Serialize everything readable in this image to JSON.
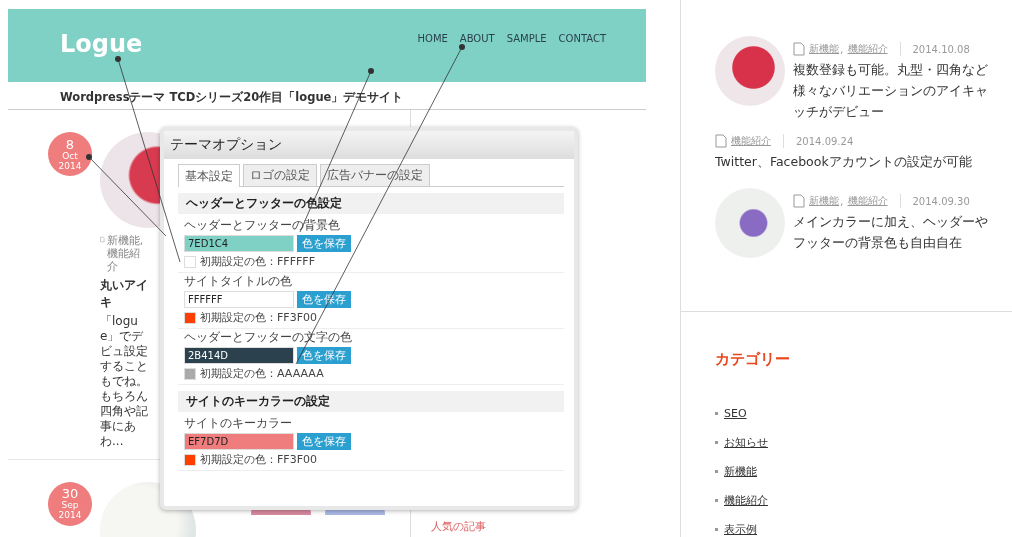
{
  "header": {
    "logo": "Logue",
    "nav": [
      "HOME",
      "ABOUT",
      "SAMPLE",
      "CONTACT"
    ]
  },
  "tagline": "Wordpressテーマ TCDシリーズ20作目「logue」デモサイト",
  "posts": [
    {
      "day": "8",
      "month": "Oct",
      "year": "2014",
      "meta": "新機能, 機能紹介",
      "title": "丸いアイキ",
      "excerpt": "「logue」でデビュ設定することもでね。もちろん四角や記事にあわ..."
    },
    {
      "day": "30",
      "month": "Sep",
      "year": "2014"
    }
  ],
  "middle_column": {
    "heading": "人気の記事"
  },
  "options_panel": {
    "title": "テーマオプション",
    "tabs": [
      {
        "label": "基本設定",
        "selected": true
      },
      {
        "label": "ロゴの設定",
        "selected": false
      },
      {
        "label": "広告バナーの設定",
        "selected": false
      }
    ],
    "sections": [
      {
        "heading": "ヘッダーとフッターの色設定",
        "fields": [
          {
            "label": "ヘッダーとフッターの背景色",
            "value": "7ED1C4",
            "button": "色を保存",
            "default_label": "初期設定の色：",
            "default_value": "FFFFFF"
          },
          {
            "label": "サイトタイトルの色",
            "value": "FFFFFF",
            "button": "色を保存",
            "default_label": "初期設定の色：",
            "default_value": "FF3F00"
          },
          {
            "label": "ヘッダーとフッターの文字の色",
            "value": "2B414D",
            "button": "色を保存",
            "default_label": "初期設定の色：",
            "default_value": "AAAAAA"
          }
        ]
      },
      {
        "heading": "サイトのキーカラーの設定",
        "fields": [
          {
            "label": "サイトのキーカラー",
            "value": "EF7D7D",
            "button": "色を保存",
            "default_label": "初期設定の色：",
            "default_value": "FF3F00"
          }
        ]
      }
    ]
  },
  "sidebar": {
    "category_separator": ",",
    "posts": [
      {
        "kind": "thumb",
        "categories": [
          "新機能",
          "機能紹介"
        ],
        "date": "2014.10.08",
        "title": "複数登録も可能。丸型・四角など様々なバリエーションのアイキャッチがデビュー"
      },
      {
        "kind": "plain",
        "categories": [
          "機能紹介"
        ],
        "date": "2014.09.24",
        "title": "Twitter、Facebookアカウントの設定が可能"
      },
      {
        "kind": "thumb",
        "categories": [
          "新機能",
          "機能紹介"
        ],
        "date": "2014.09.30",
        "title": "メインカラーに加え、ヘッダーやフッターの背景色も自由自在"
      }
    ],
    "categories_heading": "カテゴリー",
    "categories": [
      "SEO",
      "お知らせ",
      "新機能",
      "機能紹介",
      "表示例"
    ]
  }
}
